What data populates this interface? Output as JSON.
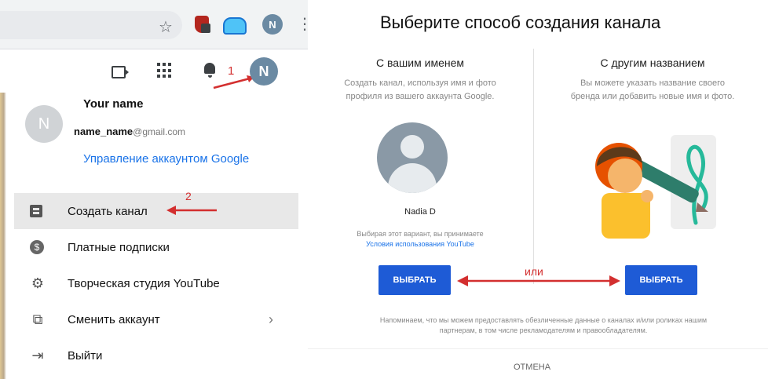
{
  "account": {
    "avatar_letter": "N",
    "name": "Your name",
    "email_user": "name_name",
    "email_domain": "@gmail.com",
    "manage_link": "Управление аккаунтом Google"
  },
  "menu": {
    "items": [
      {
        "label": "Создать канал",
        "icon": "create-channel-icon"
      },
      {
        "label": "Платные подписки",
        "icon": "paid-subscriptions-icon"
      },
      {
        "label": "Творческая студия YouTube",
        "icon": "gear-icon"
      },
      {
        "label": "Сменить аккаунт",
        "icon": "switch-account-icon"
      },
      {
        "label": "Выйти",
        "icon": "sign-out-icon"
      }
    ],
    "coin_glyph": "$"
  },
  "annotations": {
    "step1": "1",
    "step2": "2",
    "or": "или"
  },
  "dialog": {
    "title": "Выберите способ создания канала",
    "option_left": {
      "title": "С вашим именем",
      "desc_line1": "Создать канал, используя имя и фото",
      "desc_line2": "профиля из вашего аккаунта Google.",
      "name": "Nadia D",
      "terms_line1": "Выбирая этот вариант, вы принимаете",
      "terms_link": "Условия использования YouTube",
      "button": "ВЫБРАТЬ"
    },
    "option_right": {
      "title": "С другим названием",
      "desc_line1": "Вы можете указать название своего",
      "desc_line2": "бренда или добавить новые имя и фото.",
      "button": "ВЫБРАТЬ"
    },
    "footer_line1": "Напоминаем, что мы можем предоставлять обезличенные данные о каналах и/или роликах нашим",
    "footer_line2": "партнерам, в том числе рекламодателям и правообладателям.",
    "cancel": "ОТМЕНА"
  },
  "colors": {
    "accent_blue": "#1e5bd6",
    "link_blue": "#1a73e8",
    "annotation_red": "#d32f2f"
  }
}
